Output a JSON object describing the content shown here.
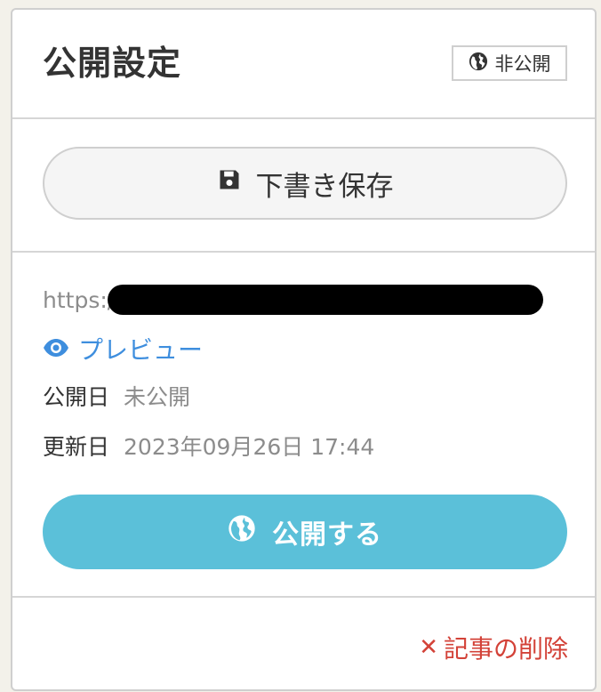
{
  "panel": {
    "title": "公開設定",
    "status_badge": {
      "icon": "globe-icon",
      "label": "非公開"
    }
  },
  "draft": {
    "icon": "save-icon",
    "label": "下書き保存"
  },
  "info": {
    "url_prefix": "https:/",
    "preview": {
      "icon": "eye-icon",
      "label": "プレビュー"
    },
    "published": {
      "label": "公開日",
      "value": "未公開"
    },
    "updated": {
      "label": "更新日",
      "value": "2023年09月26日 17:44"
    }
  },
  "publish": {
    "icon": "globe-icon",
    "label": "公開する"
  },
  "delete": {
    "icon": "close-icon",
    "icon_glyph": "✕",
    "label": "記事の削除"
  },
  "colors": {
    "accent": "#5bc0d9",
    "link": "#3e8ede",
    "danger": "#d34238",
    "text": "#333333",
    "muted": "#8c8c8c"
  }
}
